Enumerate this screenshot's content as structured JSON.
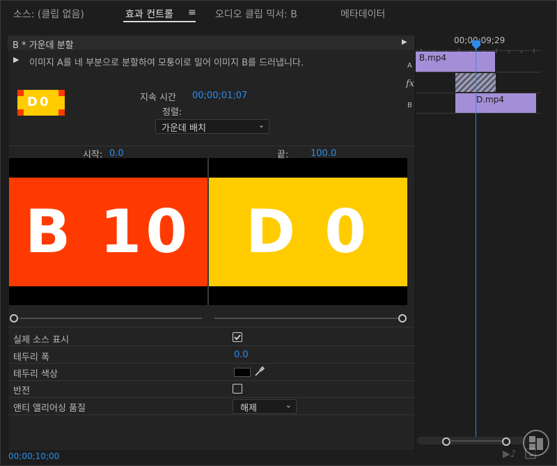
{
  "tabs": {
    "source": "소스: (클립 없음)",
    "effect_controls": "효과 컨트롤",
    "menu_glyph": "≡",
    "audio_mixer": "오디오 클립 믹서: B",
    "metadata": "메타데이터"
  },
  "effect": {
    "header": "B * 가운데 분할",
    "description": "이미지 A를 네 부분으로 분할하여 모퉁이로 밀어 이미지 B를 드러냅니다.",
    "thumb_text": "D0",
    "duration_label": "지속 시간",
    "duration_value": "00;00;01;07",
    "alignment_label": "정렬:",
    "alignment_value": "가운데 배치",
    "start_label": "시작:",
    "start_value": "0.0",
    "end_label": "끝:",
    "end_value": "100.0",
    "preview_a": "B 10",
    "preview_b": "D 0",
    "preview_a_color": "#ff3a00",
    "preview_b_color": "#ffcc00"
  },
  "properties": {
    "show_actual_sources_label": "실제 소스 표시",
    "show_actual_sources_checked": true,
    "border_width_label": "테두리 폭",
    "border_width_value": "0.0",
    "border_color_label": "테두리 색상",
    "border_color_value": "#000000",
    "reverse_label": "반전",
    "reverse_checked": false,
    "antialias_label": "앤티 앨리어싱 품질",
    "antialias_value": "해제"
  },
  "footer": {
    "timecode": "00;00;10;00"
  },
  "timeline": {
    "timecode": "00;00;09;29",
    "track_a_label": "A",
    "track_fx_label": "fx",
    "track_b_label": "B",
    "clip_a": "B.mp4",
    "clip_b": "D.mp4",
    "accent_color": "#2d8ceb",
    "clip_color": "#a48ed8"
  }
}
